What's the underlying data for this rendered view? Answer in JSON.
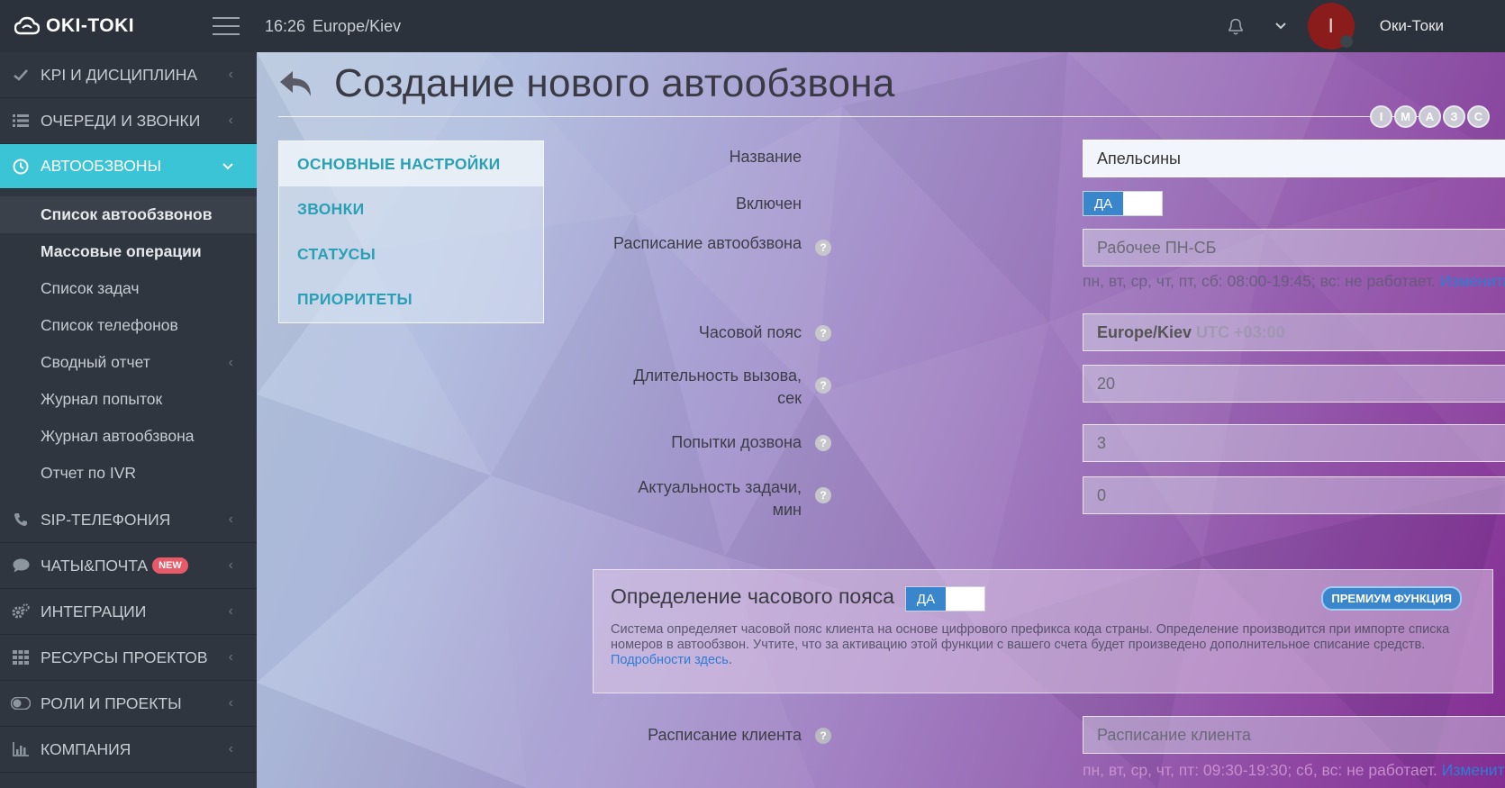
{
  "app": {
    "logo": "OKI-TOKI",
    "time": "16:26",
    "timezone": "Europe/Kiev",
    "avatar_letter": "I",
    "username": "Оки-Токи"
  },
  "sidebar": {
    "items_top": [
      {
        "label": "KPI И ДИСЦИПЛИНА",
        "icon": "check-icon"
      },
      {
        "label": "ОЧЕРЕДИ И ЗВОНКИ",
        "icon": "list-icon"
      }
    ],
    "active": {
      "label": "АВТООБЗВОНЫ",
      "icon": "clock-icon"
    },
    "subitems": [
      {
        "label": "Список автообзвонов"
      },
      {
        "label": "Массовые операции"
      },
      {
        "label": "Список задач"
      },
      {
        "label": "Список телефонов"
      },
      {
        "label": "Сводный отчет"
      },
      {
        "label": "Журнал попыток"
      },
      {
        "label": "Журнал автообзвона"
      },
      {
        "label": "Отчет по IVR"
      }
    ],
    "items_bottom": [
      {
        "label": "SIP-ТЕЛЕФОНИЯ",
        "icon": "phone-icon"
      },
      {
        "label": "ЧАТЫ&ПОЧТА",
        "icon": "chat-icon",
        "badge": "NEW"
      },
      {
        "label": "ИНТЕГРАЦИИ",
        "icon": "gears-icon"
      },
      {
        "label": "РЕСУРСЫ ПРОЕКТОВ",
        "icon": "grid-icon"
      },
      {
        "label": "РОЛИ И ПРОЕКТЫ",
        "icon": "toggle-icon"
      },
      {
        "label": "КОМПАНИЯ",
        "icon": "chart-icon"
      }
    ]
  },
  "page": {
    "title": "Создание нового автообзвона",
    "circles": [
      "I",
      "M",
      "A",
      "З",
      "C"
    ]
  },
  "tabs": [
    "ОСНОВНЫЕ НАСТРОЙКИ",
    "ЗВОНКИ",
    "СТАТУСЫ",
    "ПРИОРИТЕТЫ"
  ],
  "form": {
    "name_label": "Название",
    "name_value": "Апельсины",
    "enabled_label": "Включен",
    "enabled_on": "ДА",
    "schedule_label": "Расписание автообзвона",
    "schedule_value": "Рабочее ПН-СБ",
    "schedule_hint": "пн, вт, ср, чт, пт, сб: 08:00-19:45; вс: не работает.",
    "schedule_hint_link": "Изменить",
    "tz_label": "Часовой пояс",
    "tz_value": "Europe/Kiev",
    "tz_offset": "UTC +03:00",
    "duration_label_1": "Длительность вызова,",
    "duration_label_2": "сек",
    "duration_value": "20",
    "attempts_label": "Попытки дозвона",
    "attempts_value": "3",
    "relevance_label_1": "Актуальность задачи,",
    "relevance_label_2": "мин",
    "relevance_value": "0",
    "client_schedule_label": "Расписание клиента",
    "client_schedule_value": "Расписание клиента",
    "client_hint": "пн, вт, ср, чт, пт: 09:30-19:30; сб, вс: не работает.",
    "client_hint_link": "Изменить",
    "help_glyph": "?"
  },
  "tz_panel": {
    "title": "Определение часового пояса",
    "toggle_on": "ДА",
    "premium": "ПРЕМИУМ ФУНКЦИЯ",
    "text": "Система определяет часовой пояс клиента на основе цифрового префикса кода страны. Определение производится при импорте списка номеров в автообзвон. Учтите, что за активацию этой функции с вашего счета будет произведено дополнительное списание средств.",
    "link": "Подробности здесь",
    "link_tail": "."
  }
}
